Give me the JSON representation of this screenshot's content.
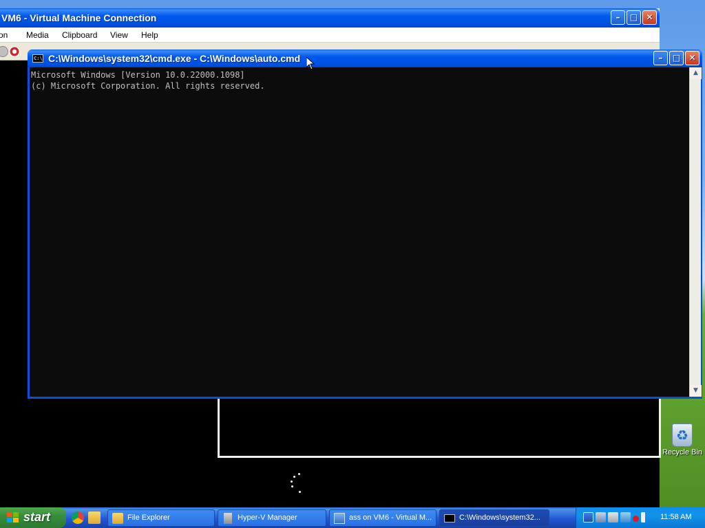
{
  "desktop": {
    "recycle_bin_label": "Recycle Bin",
    "recycle_bin_icon": "recycle-bin-icon"
  },
  "vm_window": {
    "title": "VM6 - Virtual Machine Connection",
    "menu": [
      "Action",
      "Media",
      "Clipboard",
      "View",
      "Help"
    ],
    "toolbar_icons": [
      "ctrl-alt-del-icon",
      "power-off-icon"
    ],
    "caption_buttons": [
      "minimize",
      "maximize",
      "close"
    ]
  },
  "cmd_window": {
    "title": "C:\\Windows\\system32\\cmd.exe - C:\\Windows\\auto.cmd",
    "lines": [
      "Microsoft Windows [Version 10.0.22000.1098]",
      "(c) Microsoft Corporation. All rights reserved."
    ],
    "caption_buttons": [
      "minimize",
      "maximize",
      "close"
    ]
  },
  "taskbar": {
    "start_label": "start",
    "quick_launch": [
      "chrome-icon",
      "folder-icon"
    ],
    "tasks": [
      {
        "label": "File Explorer",
        "icon": "folder-icon",
        "active": false
      },
      {
        "label": "Hyper-V Manager",
        "icon": "hyperv-manager-icon",
        "active": false
      },
      {
        "label": "ass on VM6 - Virtual M...",
        "icon": "vm-connection-icon",
        "active": false
      },
      {
        "label": "C:\\Windows\\system32...",
        "icon": "cmd-icon",
        "active": true
      }
    ],
    "tray_icons": [
      "security-shield-icon",
      "network-icon",
      "settings-icon",
      "hyperv-icon",
      "record-icon",
      "volume-icon"
    ],
    "clock": "11:58 AM"
  },
  "colors": {
    "title_blue": "#0058ee",
    "start_green": "#388e3c",
    "console_bg": "#0c0c0c",
    "console_fg": "#c0c0c0"
  }
}
